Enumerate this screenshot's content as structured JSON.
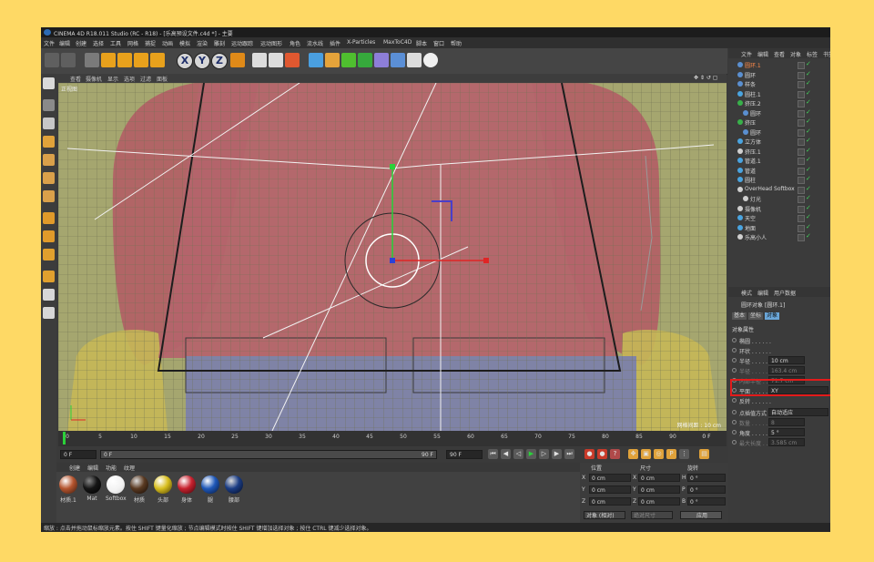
{
  "app": {
    "title": "CINEMA 4D R18.011 Studio (RC - R18) - [乐高预设文件.c4d *] - 主要"
  },
  "menubar": [
    "文件",
    "编辑",
    "创建",
    "选择",
    "工具",
    "网格",
    "捕捉",
    "动画",
    "模拟",
    "渲染",
    "雕刻",
    "运动跟踪",
    "运动图形",
    "角色",
    "流水线",
    "插件",
    "X-Particles",
    "MaxToC4D",
    "脚本",
    "窗口",
    "帮助"
  ],
  "toolbar": {
    "axis_x": "X",
    "axis_y": "Y",
    "axis_z": "Z"
  },
  "viewport": {
    "menu": [
      "查看",
      "摄像机",
      "显示",
      "选项",
      "过滤",
      "面板"
    ],
    "label": "正视图",
    "grid_spacing": "网格间距 : 10 cm"
  },
  "timeline": {
    "ticks": [
      "0",
      "5",
      "10",
      "15",
      "20",
      "25",
      "30",
      "35",
      "40",
      "45",
      "50",
      "55",
      "60",
      "65",
      "70",
      "75",
      "80",
      "85",
      "90"
    ],
    "current_frame": "0 F",
    "start_field": "0 F",
    "range_start": "0 F",
    "range_end": "90 F",
    "end_field": "90 F"
  },
  "materials": {
    "menu": [
      "创建",
      "编辑",
      "功能",
      "纹理"
    ],
    "items": [
      {
        "label": "材质.1",
        "color": "#b5552f"
      },
      {
        "label": "Mat",
        "color": "#151515"
      },
      {
        "label": "Softbox",
        "color": "#f2f2f2"
      },
      {
        "label": "材质",
        "color": "#5a3a22"
      },
      {
        "label": "头部",
        "color": "#d8be1e"
      },
      {
        "label": "身体",
        "color": "#c8222f"
      },
      {
        "label": "腿",
        "color": "#1f58b8"
      },
      {
        "label": "腰部",
        "color": "#1a3c84"
      }
    ]
  },
  "coordinates": {
    "headers": [
      "位置",
      "尺寸",
      "旋转"
    ],
    "position": {
      "x": "0 cm",
      "y": "0 cm",
      "z": "0 cm"
    },
    "size": {
      "x": "0 cm",
      "y": "0 cm",
      "z": "0 cm"
    },
    "rotation": {
      "h": "0 °",
      "p": "0 °",
      "b": "0 °"
    },
    "mode": "对象 (相对)",
    "size_mode": "绝对尺寸",
    "apply": "应用"
  },
  "objects": {
    "menu": [
      "文件",
      "编辑",
      "查看",
      "对象",
      "标签",
      "书签"
    ],
    "items": [
      {
        "name": "圆环.1",
        "selected": true
      },
      {
        "name": "圆环",
        "selected": false
      },
      {
        "name": "样条",
        "selected": false
      },
      {
        "name": "圆柱.1",
        "selected": false
      },
      {
        "name": "挤压.2",
        "selected": false
      },
      {
        "name": "圆环",
        "selected": false
      },
      {
        "name": "挤压",
        "selected": false
      },
      {
        "name": "圆环",
        "selected": false
      },
      {
        "name": "立方体",
        "selected": false
      },
      {
        "name": "挤压.1",
        "selected": false
      },
      {
        "name": "管道.1",
        "selected": false
      },
      {
        "name": "管道",
        "selected": false
      },
      {
        "name": "圆柱",
        "selected": false
      },
      {
        "name": "OverHead Softbox",
        "selected": false
      },
      {
        "name": "灯光",
        "selected": false
      },
      {
        "name": "摄像机",
        "selected": false
      },
      {
        "name": "天空",
        "selected": false
      },
      {
        "name": "地面",
        "selected": false
      },
      {
        "name": "乐高小人",
        "selected": false
      }
    ]
  },
  "attributes": {
    "menu": [
      "模式",
      "编辑",
      "用户数据"
    ],
    "title": "圆环对象 [圆环.1]",
    "tabs": [
      "基本",
      "坐标",
      "对象"
    ],
    "section": "对象属性",
    "rows": [
      {
        "name": "椭圆 . . . . . .",
        "value": ""
      },
      {
        "name": "环状 . . . . . .",
        "value": ""
      },
      {
        "name": "半径 . . . . . .",
        "value": "10 cm"
      },
      {
        "name": "半径 . . . . . .",
        "value": "163.4 cm"
      },
      {
        "name": "内部半径 . . . .",
        "value": "71.7 cm"
      },
      {
        "name": "平面 . . . . . .",
        "value": "XY"
      },
      {
        "name": "反转 . . . . . .",
        "value": ""
      },
      {
        "name": "点插值方式",
        "value": "自动适应"
      },
      {
        "name": "数量 . . . . . .",
        "value": "8"
      },
      {
        "name": "角度 . . . . . .",
        "value": "5 °"
      },
      {
        "name": "最大长度 . . . .",
        "value": "3.585 cm"
      }
    ]
  },
  "statusbar": "缩放 : 点击并拖动鼠标缩放元素。按住 SHIFT 键量化缩放 ; 节点编辑模式时按住 SHIFT 键增加选择对象 ; 按住 CTRL 键减少选择对象。"
}
